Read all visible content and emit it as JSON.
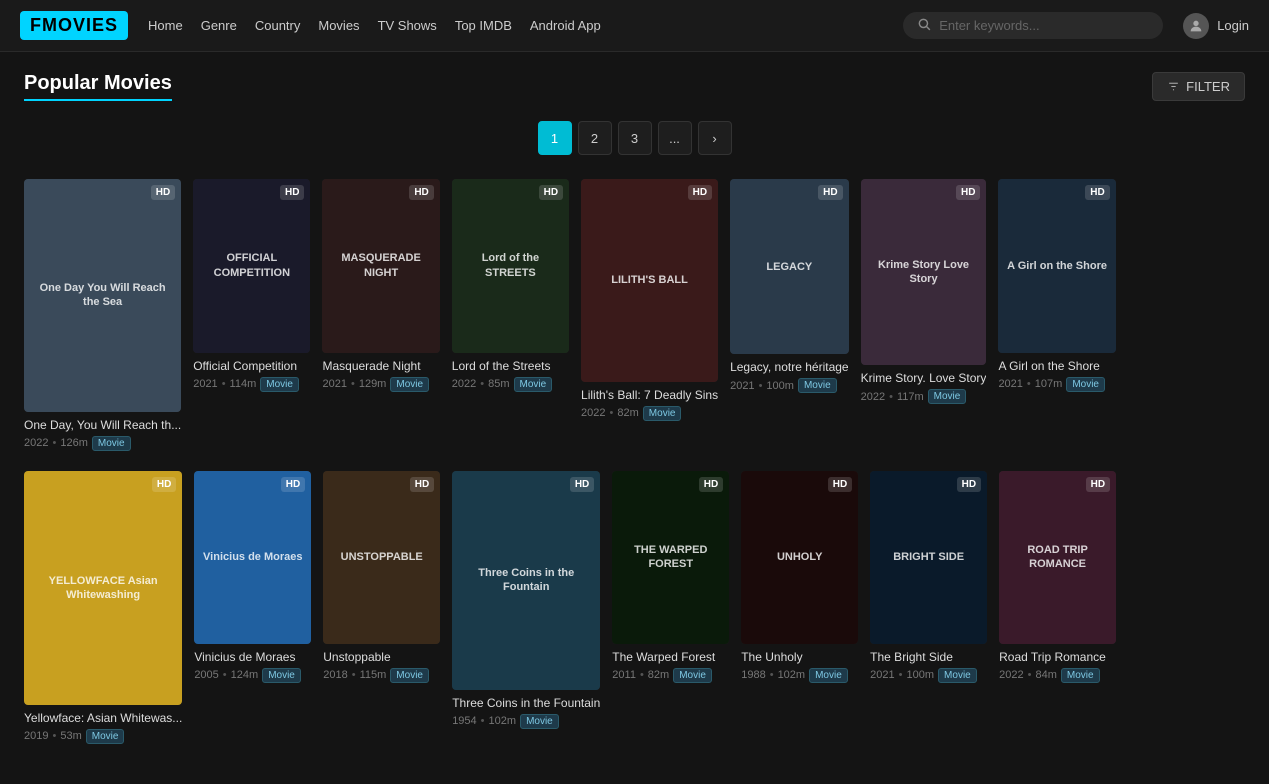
{
  "navbar": {
    "logo": "FMOVIES",
    "links": [
      "Home",
      "Genre",
      "Country",
      "Movies",
      "TV Shows",
      "Top IMDB",
      "Android App"
    ],
    "search_placeholder": "Enter keywords...",
    "login_label": "Login"
  },
  "page": {
    "title": "Popular Movies",
    "filter_label": "FILTER"
  },
  "pagination": {
    "pages": [
      "1",
      "2",
      "3",
      "...",
      ">"
    ],
    "active": 0
  },
  "movies_row1": [
    {
      "title": "One Day, You Will Reach th...",
      "year": "2022",
      "duration": "126m",
      "type": "Movie",
      "quality": "HD",
      "bg": "#3a4a5a",
      "poster_text": "One Day You Will Reach the Sea"
    },
    {
      "title": "Official Competition",
      "year": "2021",
      "duration": "114m",
      "type": "Movie",
      "quality": "HD",
      "bg": "#1a1a2a",
      "poster_text": "OFFICIAL COMPETITION"
    },
    {
      "title": "Masquerade Night",
      "year": "2021",
      "duration": "129m",
      "type": "Movie",
      "quality": "HD",
      "bg": "#2a1a1a",
      "poster_text": "MASQUERADE NIGHT"
    },
    {
      "title": "Lord of the Streets",
      "year": "2022",
      "duration": "85m",
      "type": "Movie",
      "quality": "HD",
      "bg": "#1a2a1a",
      "poster_text": "Lord of the STREETS"
    },
    {
      "title": "Lilith's Ball: 7 Deadly Sins",
      "year": "2022",
      "duration": "82m",
      "type": "Movie",
      "quality": "HD",
      "bg": "#3a1a1a",
      "poster_text": "LILITH'S BALL"
    },
    {
      "title": "Legacy, notre héritage",
      "year": "2021",
      "duration": "100m",
      "type": "Movie",
      "quality": "HD",
      "bg": "#2a3a4a",
      "poster_text": "LEGACY"
    },
    {
      "title": "Krime Story. Love Story",
      "year": "2022",
      "duration": "117m",
      "type": "Movie",
      "quality": "HD",
      "bg": "#3a2a3a",
      "poster_text": "Krime Story Love Story"
    },
    {
      "title": "A Girl on the Shore",
      "year": "2021",
      "duration": "107m",
      "type": "Movie",
      "quality": "HD",
      "bg": "#1a2a3a",
      "poster_text": "A Girl on the Shore"
    }
  ],
  "movies_row2": [
    {
      "title": "Yellowface: Asian Whitewas...",
      "year": "2019",
      "duration": "53m",
      "type": "Movie",
      "quality": "HD",
      "bg": "#c8a020",
      "poster_text": "YELLOWFACE Asian Whitewashing"
    },
    {
      "title": "Vinicius de Moraes",
      "year": "2005",
      "duration": "124m",
      "type": "Movie",
      "quality": "HD",
      "bg": "#2060a0",
      "poster_text": "Vinicius de Moraes"
    },
    {
      "title": "Unstoppable",
      "year": "2018",
      "duration": "115m",
      "type": "Movie",
      "quality": "HD",
      "bg": "#3a2a1a",
      "poster_text": "UNSTOPPABLE"
    },
    {
      "title": "Three Coins in the Fountain",
      "year": "1954",
      "duration": "102m",
      "type": "Movie",
      "quality": "HD",
      "bg": "#1a3a4a",
      "poster_text": "Three Coins in the Fountain"
    },
    {
      "title": "The Warped Forest",
      "year": "2011",
      "duration": "82m",
      "type": "Movie",
      "quality": "HD",
      "bg": "#0a1a0a",
      "poster_text": "THE WARPED FOREST"
    },
    {
      "title": "The Unholy",
      "year": "1988",
      "duration": "102m",
      "type": "Movie",
      "quality": "HD",
      "bg": "#1a0a0a",
      "poster_text": "UNHOLY"
    },
    {
      "title": "The Bright Side",
      "year": "2021",
      "duration": "100m",
      "type": "Movie",
      "quality": "HD",
      "bg": "#0a1a2a",
      "poster_text": "BRIGHT SIDE"
    },
    {
      "title": "Road Trip Romance",
      "year": "2022",
      "duration": "84m",
      "type": "Movie",
      "quality": "HD",
      "bg": "#3a1a2a",
      "poster_text": "ROAD TRIP ROMANCE"
    }
  ]
}
